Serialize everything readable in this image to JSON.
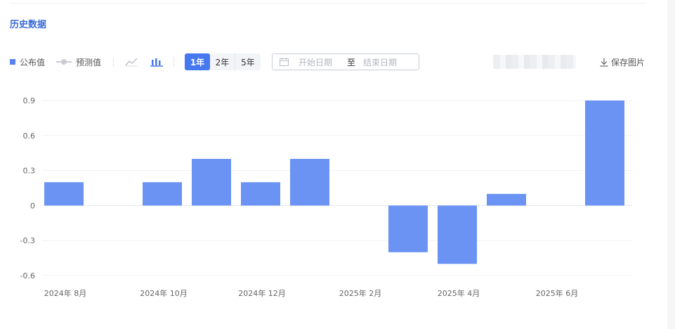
{
  "section": {
    "title": "历史数据"
  },
  "legend": {
    "published_label": "公布值",
    "forecast_label": "预测值"
  },
  "icons": {
    "line_view": "line-chart-icon",
    "bar_view": "bar-chart-icon",
    "calendar": "calendar-icon",
    "download": "download-icon"
  },
  "range_buttons": [
    "1年",
    "2年",
    "5年"
  ],
  "range_selected": "1年",
  "date_range": {
    "start_placeholder": "开始日期",
    "separator": "至",
    "end_placeholder": "结束日期"
  },
  "toolbar": {
    "save_label": "保存图片"
  },
  "colors": {
    "accent": "#4678f0",
    "bar": "#6a93f4",
    "title": "#3a6ad8"
  },
  "chart_data": {
    "type": "bar",
    "categories": [
      "2024年 8月",
      "2024年 9月",
      "2024年 10月",
      "2024年 11月",
      "2024年 12月",
      "2025年 1月",
      "2025年 2月",
      "2025年 3月",
      "2025年 4月",
      "2025年 5月",
      "2025年 6月",
      "2025年 7月"
    ],
    "series": [
      {
        "values": [
          0.2,
          0,
          0.2,
          0.4,
          0.2,
          0.4,
          0,
          -0.4,
          -0.5,
          0.1,
          0,
          0.9
        ]
      }
    ],
    "x_tick_labels": [
      "2024年 8月",
      "2024年 10月",
      "2024年 12月",
      "2025年 2月",
      "2025年 4月",
      "2025年 6月"
    ],
    "y_ticks": [
      -0.6,
      -0.3,
      0,
      0.3,
      0.6,
      0.9
    ],
    "y_tick_labels": [
      "-0.6",
      "-0.3",
      "0",
      "0.3",
      "0.6",
      "0.9"
    ],
    "ylim": [
      -0.6,
      0.9
    ],
    "grid": true,
    "legend_placement": "top-left"
  }
}
